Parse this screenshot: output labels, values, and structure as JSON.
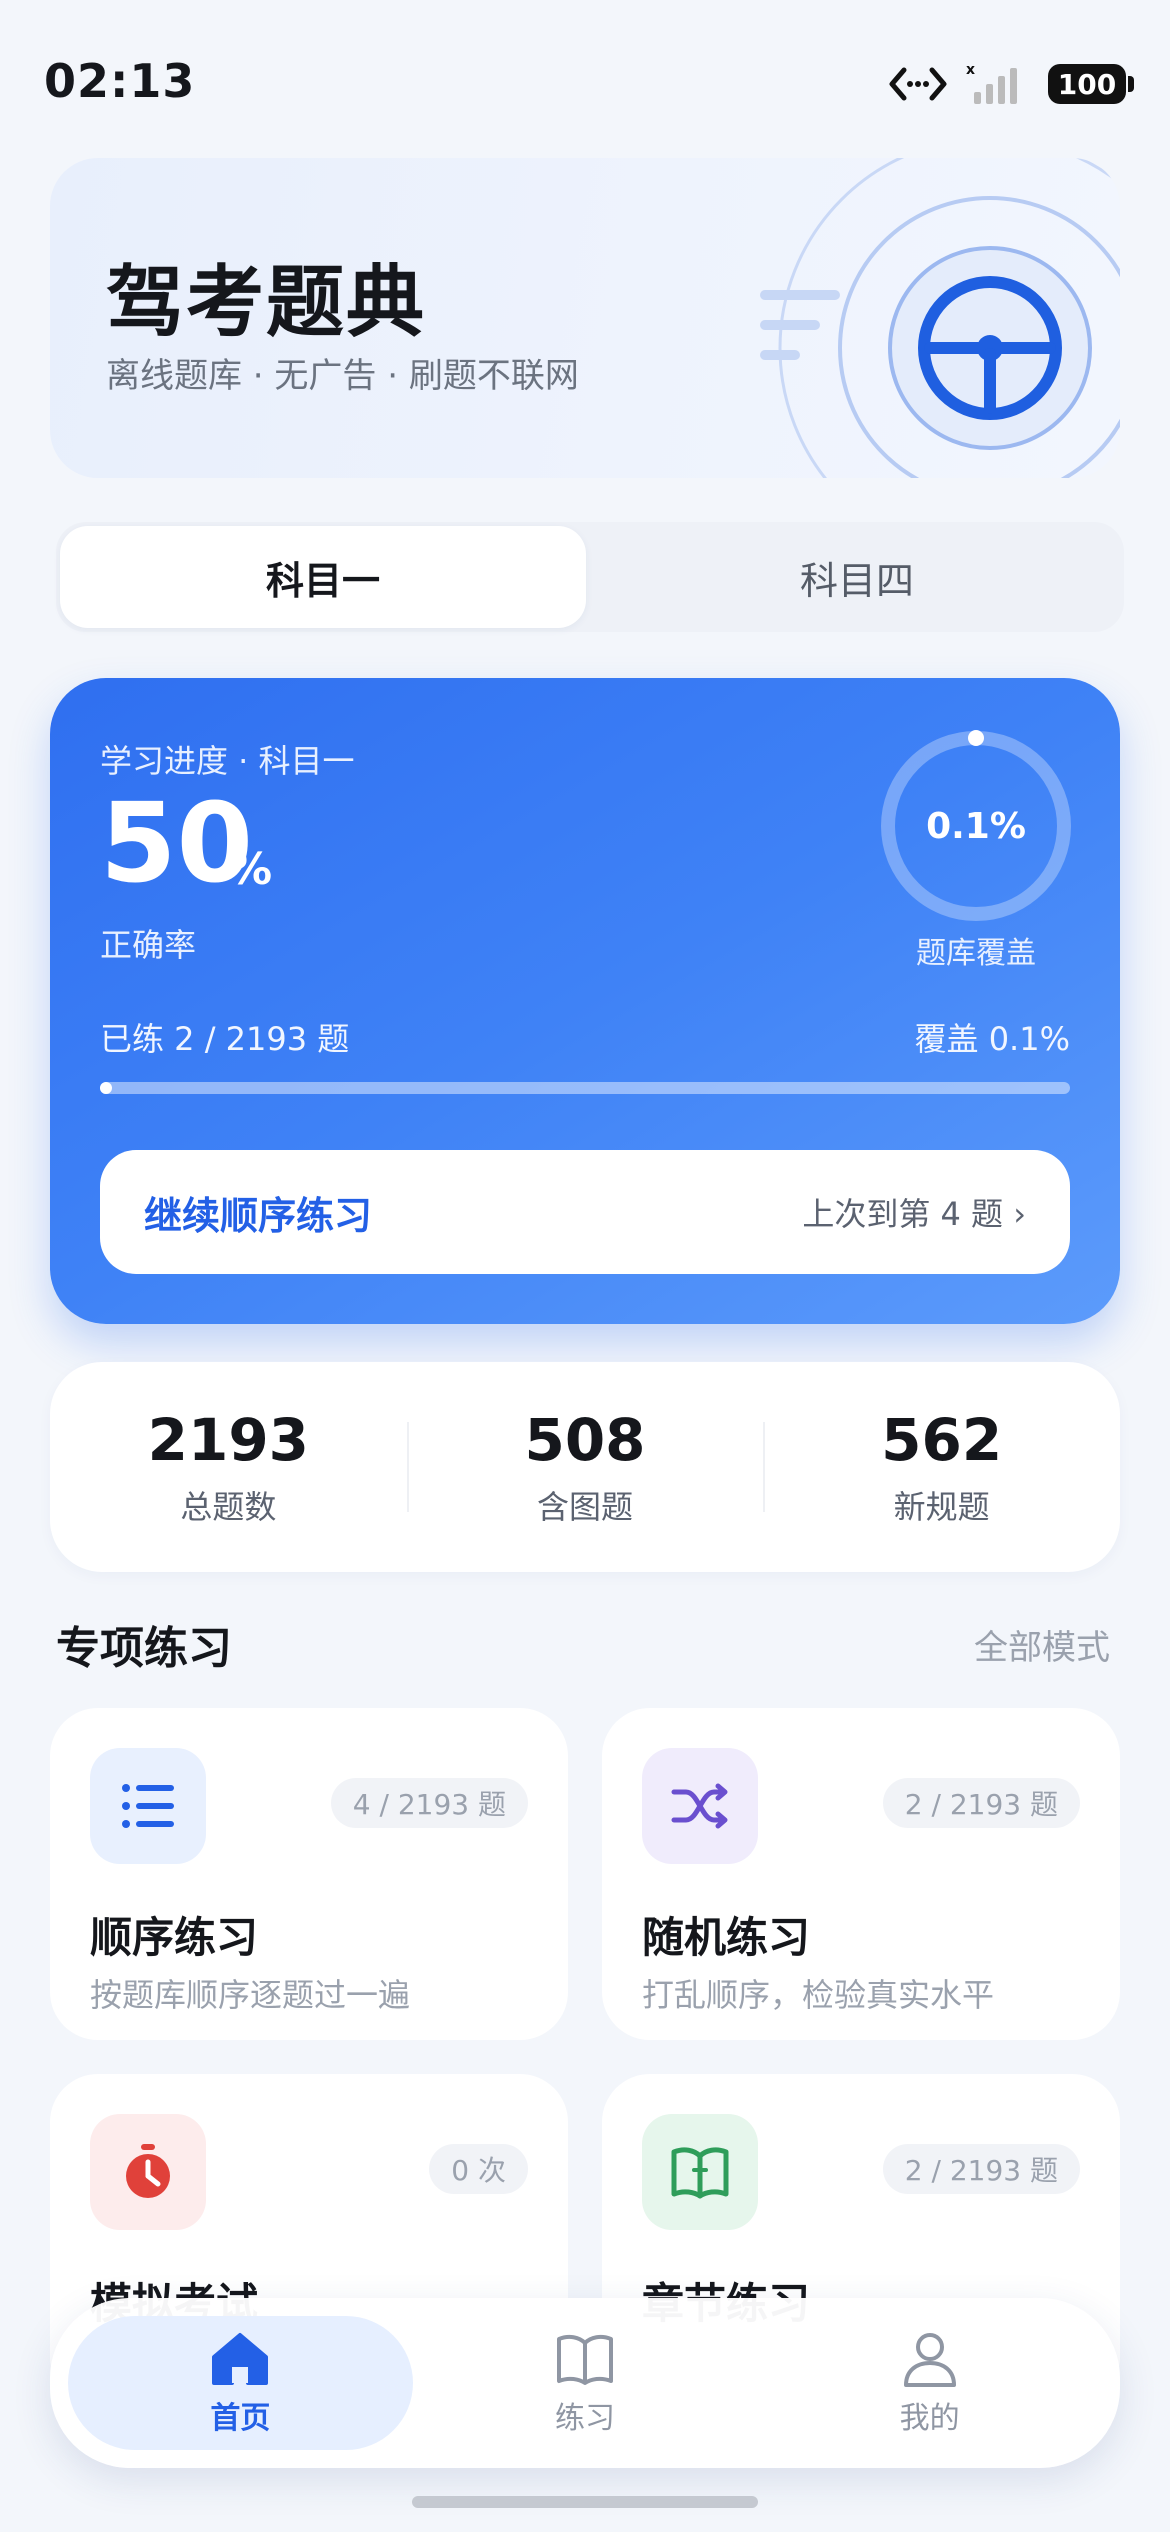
{
  "status_bar": {
    "time": "02:13",
    "battery": "100"
  },
  "hero": {
    "title": "驾考题典",
    "subtitle": "离线题库 · 无广告 · 刷题不联网",
    "icon": "steering-wheel-icon"
  },
  "tabs": [
    {
      "label": "科目一",
      "active": true
    },
    {
      "label": "科目四",
      "active": false
    }
  ],
  "progress": {
    "label": "学习进度 · 科目一",
    "accuracy": "50",
    "accuracy_unit": "%",
    "accuracy_label": "正确率",
    "coverage_value": "0.1%",
    "coverage_fraction": 0.001,
    "coverage_label": "题库覆盖",
    "practiced_text": "已练 2 / 2193 题",
    "coverage_text": "覆盖 0.1%",
    "continue_label": "继续顺序练习",
    "last_position": "上次到第 4 题 ›"
  },
  "stats": [
    {
      "value": "2193",
      "label": "总题数"
    },
    {
      "value": "508",
      "label": "含图题"
    },
    {
      "value": "562",
      "label": "新规题"
    }
  ],
  "section": {
    "title": "专项练习",
    "link": "全部模式"
  },
  "practice_cards": [
    {
      "title": "顺序练习",
      "desc": "按题库顺序逐题过一遍",
      "badge": "4 / 2193 题",
      "icon": "list-icon",
      "icon_bg": "#e8f0fe",
      "icon_color": "#2360e6"
    },
    {
      "title": "随机练习",
      "desc": "打乱顺序，检验真实水平",
      "badge": "2 / 2193 题",
      "icon": "shuffle-icon",
      "icon_bg": "#f0ecfc",
      "icon_color": "#6a4fcf"
    },
    {
      "title": "模拟考试",
      "desc": "",
      "badge": "0 次",
      "icon": "stopwatch-icon",
      "icon_bg": "#fdecec",
      "icon_color": "#e0413a"
    },
    {
      "title": "章节练习",
      "desc": "",
      "badge": "2 / 2193 题",
      "icon": "book-icon",
      "icon_bg": "#e6f6ec",
      "icon_color": "#2f9d5a"
    }
  ],
  "bottom_nav": [
    {
      "label": "首页",
      "icon": "home-icon",
      "active": true
    },
    {
      "label": "练习",
      "icon": "book-open-icon",
      "active": false
    },
    {
      "label": "我的",
      "icon": "user-icon",
      "active": false
    }
  ],
  "colors": {
    "accent": "#2360e6",
    "card_gradient_start": "#2f6ff0",
    "card_gradient_end": "#5c9bfb",
    "background": "#f3f6fb"
  }
}
